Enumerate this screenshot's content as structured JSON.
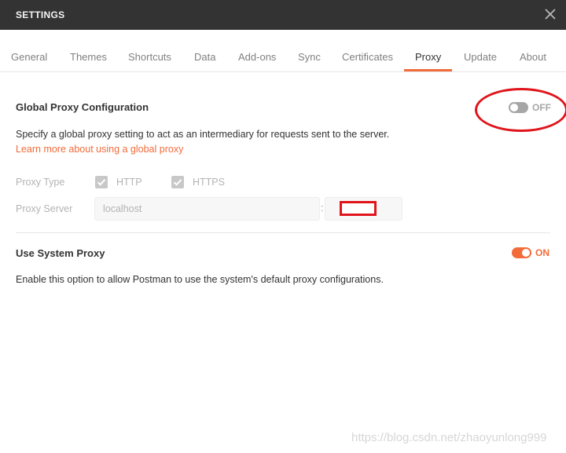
{
  "window": {
    "title": "SETTINGS",
    "close_icon": "close-icon"
  },
  "tabs": [
    {
      "label": "General"
    },
    {
      "label": "Themes"
    },
    {
      "label": "Shortcuts"
    },
    {
      "label": "Data"
    },
    {
      "label": "Add-ons"
    },
    {
      "label": "Sync"
    },
    {
      "label": "Certificates"
    },
    {
      "label": "Proxy",
      "active": true
    },
    {
      "label": "Update"
    },
    {
      "label": "About"
    }
  ],
  "global_proxy": {
    "title": "Global Proxy Configuration",
    "toggle_state": "OFF",
    "description": "Specify a global proxy setting to act as an intermediary for requests sent to the server.",
    "learn_more": "Learn more about using a global proxy",
    "proxy_type_label": "Proxy Type",
    "http_label": "HTTP",
    "http_checked": true,
    "https_label": "HTTPS",
    "https_checked": true,
    "proxy_server_label": "Proxy Server",
    "server_value": "localhost",
    "colon": ":",
    "port_value": ""
  },
  "system_proxy": {
    "title": "Use System Proxy",
    "toggle_state": "ON",
    "description": "Enable this option to allow Postman to use the system's default proxy configurations."
  },
  "watermark": "https://blog.csdn.net/zhaoyunlong999",
  "colors": {
    "accent": "#f26b3a",
    "titlebar": "#333333",
    "annotation_red": "#e0141b"
  }
}
